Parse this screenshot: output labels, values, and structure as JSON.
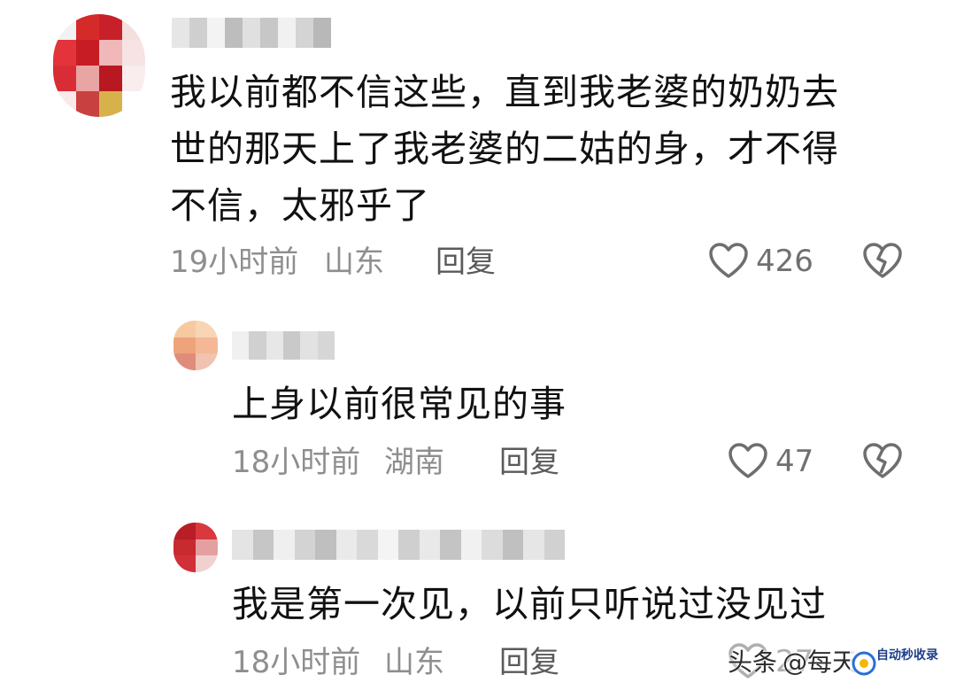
{
  "comments": [
    {
      "text_lines": [
        "我以前都不信这些，直到我老婆的奶奶去",
        "世的那天上了我老婆的二姑的身，才不得",
        "不信，太邪乎了"
      ],
      "time": "19小时前",
      "location": "山东",
      "reply_label": "回复",
      "likes": "426",
      "avatar_icon": "avatar-icon",
      "username_blurred": true
    },
    {
      "text_lines": [
        "上身以前很常见的事"
      ],
      "time": "18小时前",
      "location": "湖南",
      "reply_label": "回复",
      "likes": "47",
      "avatar_icon": "avatar-icon",
      "username_blurred": true
    },
    {
      "text_lines": [
        "我是第一次见，以前只听说过没见过"
      ],
      "time": "18小时前",
      "location": "山东",
      "reply_label": "回复",
      "likes": "27",
      "avatar_icon": "avatar-icon",
      "username_blurred": true
    }
  ],
  "watermark": {
    "platform": "头条",
    "handle": "@每天",
    "logo_text": "自动秒收录"
  },
  "colors": {
    "text": "#111111",
    "meta": "#8e8e8e",
    "reply": "#5a5a5a",
    "icon_stroke": "#6e6e6e"
  }
}
